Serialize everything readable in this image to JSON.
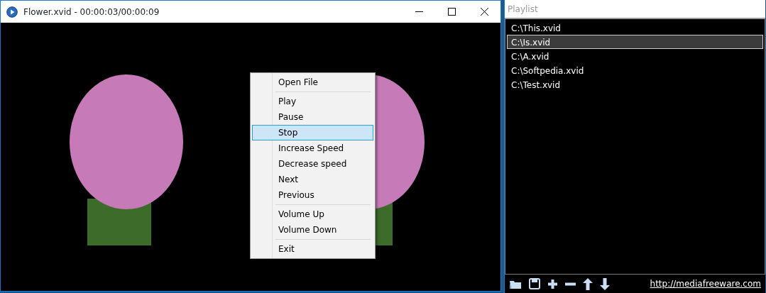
{
  "window": {
    "title": "Flower.xvid - 00:00:03/00:00:09"
  },
  "context_menu": {
    "items": [
      {
        "kind": "item",
        "label": "Open File",
        "selected": false
      },
      {
        "kind": "separator"
      },
      {
        "kind": "item",
        "label": "Play",
        "selected": false
      },
      {
        "kind": "item",
        "label": "Pause",
        "selected": false
      },
      {
        "kind": "item",
        "label": "Stop",
        "selected": true
      },
      {
        "kind": "item",
        "label": "Increase Speed",
        "selected": false
      },
      {
        "kind": "item",
        "label": "Decrease speed",
        "selected": false
      },
      {
        "kind": "item",
        "label": "Next",
        "selected": false
      },
      {
        "kind": "item",
        "label": "Previous",
        "selected": false
      },
      {
        "kind": "separator"
      },
      {
        "kind": "item",
        "label": "Volume Up",
        "selected": false
      },
      {
        "kind": "item",
        "label": "Volume Down",
        "selected": false
      },
      {
        "kind": "separator"
      },
      {
        "kind": "item",
        "label": "Exit",
        "selected": false
      }
    ]
  },
  "playlist": {
    "title": "Playlist",
    "items": [
      {
        "label": "C:\\This.xvid",
        "selected": false
      },
      {
        "label": "C:\\Is.xvid",
        "selected": true
      },
      {
        "label": "C:\\A.xvid",
        "selected": false
      },
      {
        "label": "C:\\Softpedia.xvid",
        "selected": false
      },
      {
        "label": "C:\\Test.xvid",
        "selected": false
      }
    ],
    "link": "http://mediafreeware.com"
  }
}
